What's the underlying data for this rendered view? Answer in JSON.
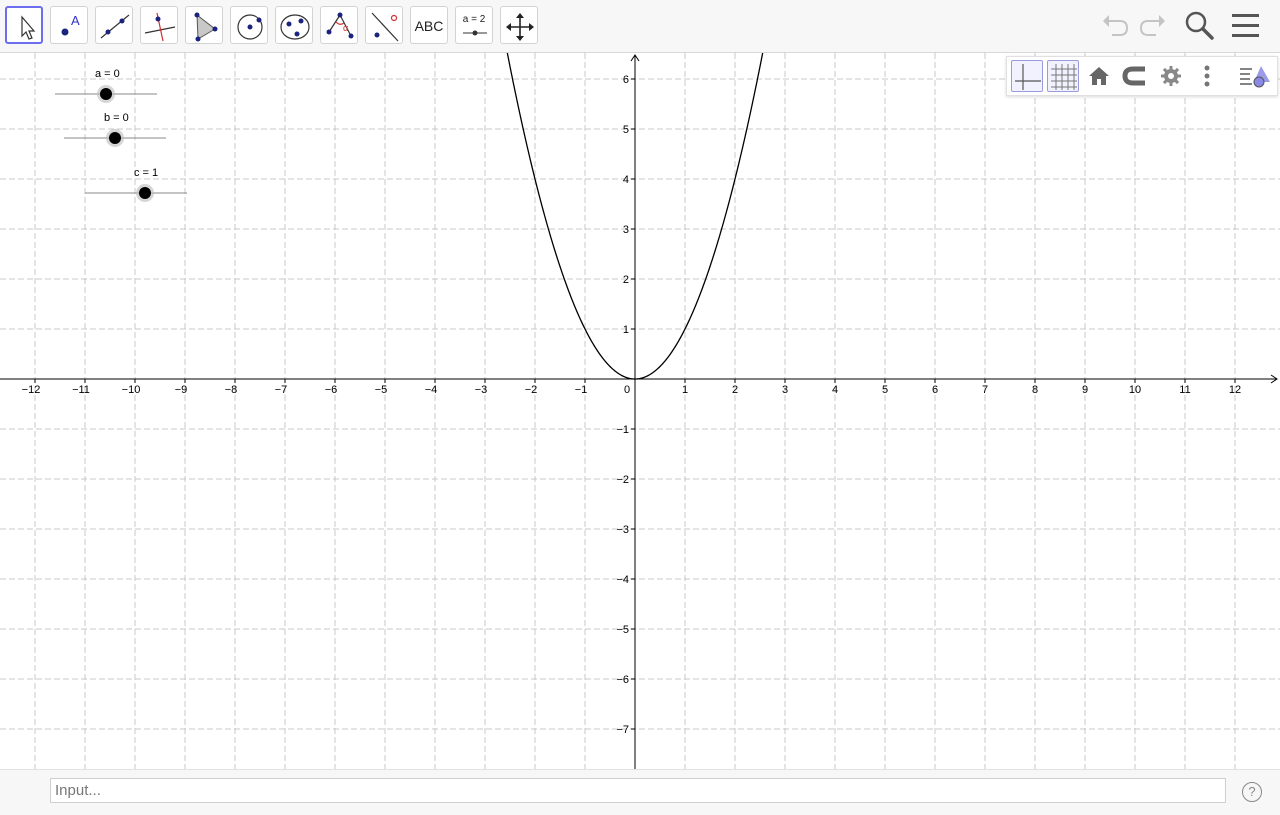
{
  "toolbar": {
    "tools": [
      {
        "name": "move-tool",
        "selected": true
      },
      {
        "name": "point-tool",
        "label": "A"
      },
      {
        "name": "line-tool"
      },
      {
        "name": "perpendicular-line-tool"
      },
      {
        "name": "polygon-tool"
      },
      {
        "name": "circle-tool"
      },
      {
        "name": "conic-tool"
      },
      {
        "name": "angle-tool",
        "label": "α"
      },
      {
        "name": "reflect-tool"
      },
      {
        "name": "text-tool",
        "label": "ABC"
      },
      {
        "name": "slider-tool",
        "label": "a = 2"
      },
      {
        "name": "move-graphics-tool"
      }
    ],
    "undo_icon": "undo-icon",
    "redo_icon": "redo-icon",
    "search_icon": "search-icon",
    "menu_icon": "menu-icon"
  },
  "style_bar": {
    "buttons": [
      "axes-toggle",
      "grid-toggle",
      "standard-view",
      "point-capturing",
      "graphics-settings",
      "more",
      "toggle-style-bar"
    ]
  },
  "sliders": [
    {
      "name": "a",
      "label": "a = 0",
      "value": 0
    },
    {
      "name": "b",
      "label": "b = 0",
      "value": 0
    },
    {
      "name": "c",
      "label": "c = 1",
      "value": 1
    }
  ],
  "chart_data": {
    "type": "line",
    "x_ticks": [
      "−12",
      "−11",
      "−10",
      "−9",
      "−8",
      "−7",
      "−6",
      "−5",
      "−4",
      "−3",
      "−2",
      "−1",
      "0",
      "1",
      "2",
      "3",
      "4",
      "5",
      "6",
      "7",
      "8",
      "9",
      "10",
      "11",
      "12"
    ],
    "y_ticks": [
      "6",
      "5",
      "4",
      "3",
      "2",
      "1",
      "−1",
      "−2",
      "−3",
      "−4",
      "−5",
      "−6",
      "−7"
    ],
    "xlim": [
      -12.7,
      12.9
    ],
    "ylim": [
      -7.8,
      6.5
    ],
    "grid": true,
    "series": [
      {
        "function": "x^2",
        "color": "#000000",
        "x": [
          -2.6,
          -2.4,
          -2.2,
          -2,
          -1.8,
          -1.6,
          -1.4,
          -1.2,
          -1,
          -0.8,
          -0.6,
          -0.4,
          -0.2,
          0,
          0.2,
          0.4,
          0.6,
          0.8,
          1,
          1.2,
          1.4,
          1.6,
          1.8,
          2,
          2.2,
          2.4,
          2.6
        ],
        "y": [
          6.76,
          5.76,
          4.84,
          4,
          3.24,
          2.56,
          1.96,
          1.44,
          1,
          0.64,
          0.36,
          0.16,
          0.04,
          0,
          0.04,
          0.16,
          0.36,
          0.64,
          1,
          1.44,
          1.96,
          2.56,
          3.24,
          4,
          4.84,
          5.76,
          6.76
        ]
      }
    ]
  },
  "input_bar": {
    "placeholder": "Input...",
    "help_label": "?"
  }
}
